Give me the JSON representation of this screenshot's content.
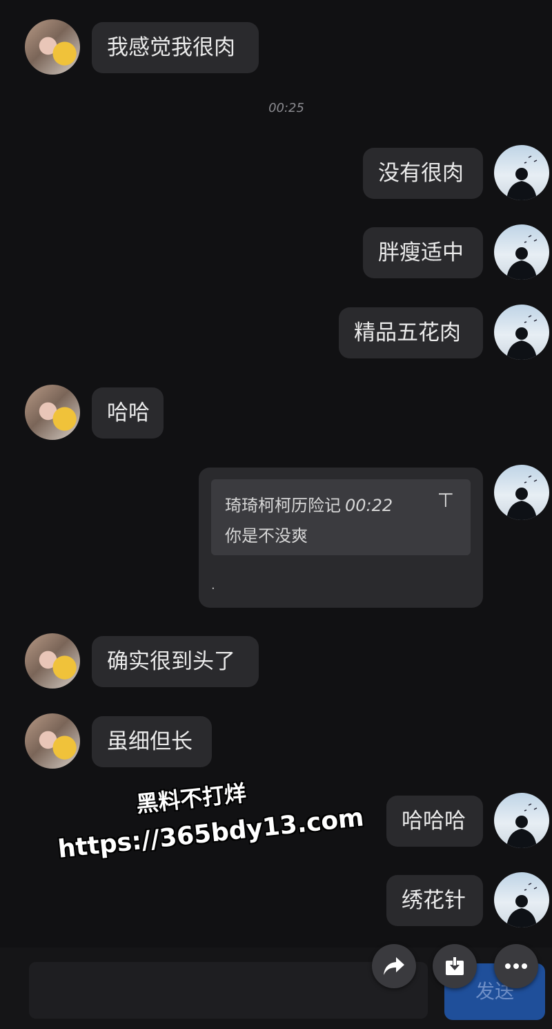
{
  "chat": {
    "timestamp": "00:25",
    "messages": [
      {
        "from": "them",
        "text": "我感觉我很肉"
      },
      {
        "from": "me",
        "text": "没有很肉"
      },
      {
        "from": "me",
        "text": "胖瘦适中"
      },
      {
        "from": "me",
        "text": "精品五花肉"
      },
      {
        "from": "them",
        "text": "哈哈"
      },
      {
        "from": "me",
        "text": "."
      },
      {
        "from": "them",
        "text": "确实很到头了"
      },
      {
        "from": "them",
        "text": "虽细但长"
      },
      {
        "from": "me",
        "text": "哈哈哈"
      },
      {
        "from": "me",
        "text": "绣花针"
      }
    ],
    "quote": {
      "name": "琦琦柯柯历险记",
      "time": "00:22",
      "text": "你是不没爽",
      "pin_icon": "⊤"
    }
  },
  "watermark": {
    "line1": "黑料不打烊",
    "line2": "https://365bdy13.com"
  },
  "input": {
    "send_label": "发送"
  },
  "colors": {
    "background": "#111113",
    "bubble": "#2a2a2d",
    "send": "#1f4f9a"
  }
}
